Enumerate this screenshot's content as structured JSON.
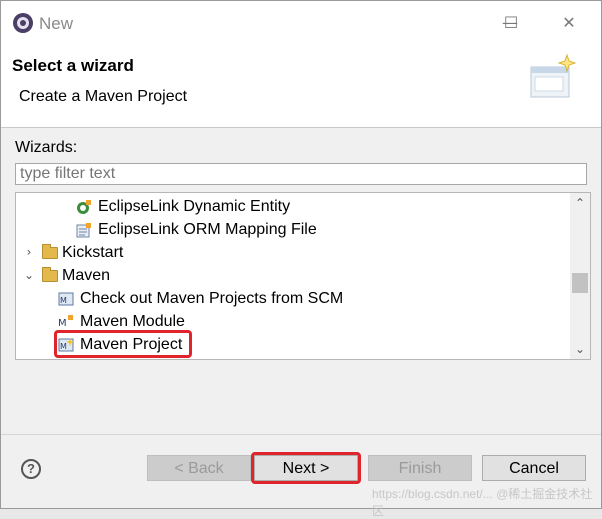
{
  "window": {
    "title": "New",
    "minimize": "—",
    "maximize": "☐",
    "close": "✕"
  },
  "header": {
    "title": "Select a wizard",
    "description": "Create a Maven Project"
  },
  "wizards": {
    "label": "Wizards:",
    "filter_placeholder": "type filter text"
  },
  "tree": {
    "items": [
      {
        "label": "EclipseLink Dynamic Entity",
        "icon": "eclipselink-entity-icon"
      },
      {
        "label": "EclipseLink ORM Mapping File",
        "icon": "eclipselink-orm-icon"
      },
      {
        "label": "Kickstart",
        "icon": "folder-icon",
        "expanded": false
      },
      {
        "label": "Maven",
        "icon": "folder-icon",
        "expanded": true
      },
      {
        "label": "Check out Maven Projects from SCM",
        "icon": "maven-scm-icon"
      },
      {
        "label": "Maven Module",
        "icon": "maven-module-icon"
      },
      {
        "label": "Maven Project",
        "icon": "maven-project-icon",
        "selected": true
      }
    ]
  },
  "buttons": {
    "help": "?",
    "back": "< Back",
    "next": "Next >",
    "finish": "Finish",
    "cancel": "Cancel"
  },
  "watermark": "https://blog.csdn.net/... @稀土掘金技术社区",
  "colors": {
    "highlight": "#e0242b",
    "folder": "#e3b84c"
  }
}
